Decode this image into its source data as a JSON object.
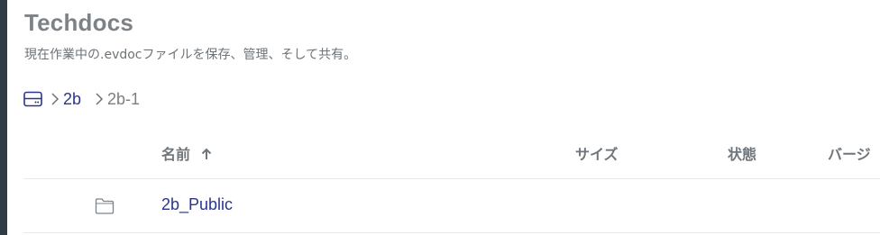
{
  "page": {
    "title": "Techdocs",
    "subtitle": "現在作業中の.evdocファイルを保存、管理、そして共有。"
  },
  "breadcrumb": {
    "root_icon": "drive-icon",
    "items": [
      {
        "label": "2b",
        "link": true
      },
      {
        "label": "2b-1",
        "link": false
      }
    ]
  },
  "table": {
    "columns": {
      "name": "名前",
      "size": "サイズ",
      "status": "状態",
      "version": "バージ"
    },
    "sort": {
      "column": "name",
      "direction": "ascending",
      "icon": "arrow-up-icon"
    },
    "rows": [
      {
        "icon": "folder-icon",
        "name": "2b_Public"
      }
    ]
  },
  "colors": {
    "link": "#2b3590",
    "title": "#7c8388",
    "edge": "#2f3b45"
  }
}
